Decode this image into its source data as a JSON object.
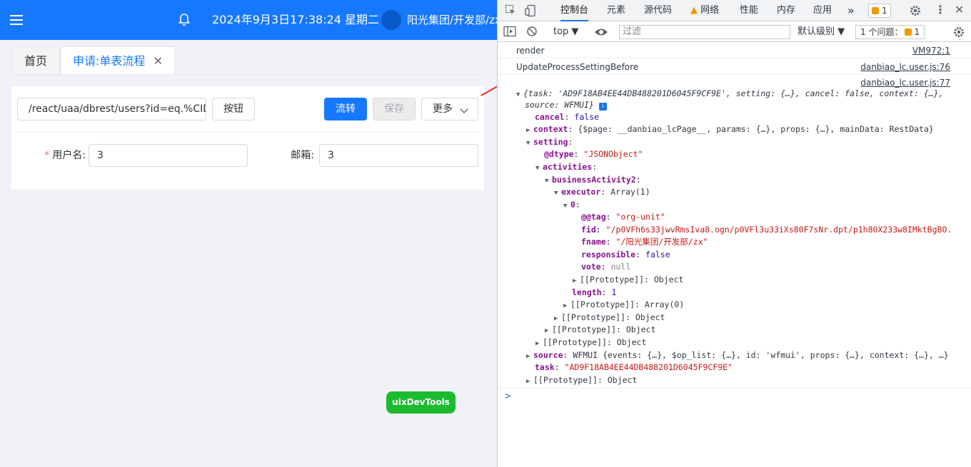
{
  "header": {
    "datetime": "2024年9月3日17:38:24 星期二",
    "user": "阳光集团/开发部/zx",
    "icons": [
      "menu-icon",
      "bell-icon"
    ],
    "color": "#1677ff"
  },
  "tabs": {
    "home": "首页",
    "active": "申请:单表流程",
    "close": "✕"
  },
  "form": {
    "url_value": "/react/uaa/dbrest/users?id=eq.%CID%",
    "btn_button": "按钮",
    "btn_flow": "流转",
    "btn_save": "保存",
    "btn_more": "更多",
    "required_mark": "*",
    "username_label": "用户名:",
    "username_value": "3",
    "email_label": "邮箱:",
    "email_value": "3"
  },
  "uix": {
    "label": "uixDevTools"
  },
  "devtools": {
    "tabs": [
      "控制台",
      "元素",
      "源代码",
      "网络",
      "性能",
      "内存",
      "应用"
    ],
    "more": "»",
    "warn_badge": "1",
    "context": "top ▼",
    "filter_placeholder": "过滤",
    "level": "默认级别 ▼",
    "issues_text": "1 个问题：",
    "issues_count": "1",
    "log": [
      {
        "msg": "render",
        "src": "VM972:1"
      },
      {
        "msg": "UpdateProcessSettingBefore",
        "src": "danbiao_lc.user.js:76"
      },
      {
        "src": "danbiao_lc.user.js:77"
      }
    ],
    "tree": {
      "l0": "{task: 'AD9F18AB4EE44DB488201D6045F9CF9E', setting: {…}, cancel: false, context: {…},",
      "l0b": "source: WFMUI}",
      "cancel_k": "cancel",
      "cancel_v": "false",
      "context_k": "context",
      "context_v": "{$page: __danbiao_lcPage__, params: {…}, props: {…}, mainData: RestData}",
      "setting_k": "setting",
      "dtype_k": "@dtype",
      "dtype_v": "\"JSONObject\"",
      "activities_k": "activities",
      "ba_k": "businessActivity2",
      "executor_k": "executor",
      "executor_v": "Array(1)",
      "zero_k": "0",
      "tag_k": "@@tag",
      "tag_v": "\"org-unit\"",
      "fid_k": "fid",
      "fid_v": "\"/p0VFh6s33jwvRmsIva8.ogn/p0VFl3u33iXs80F7sNr.dpt/p1h80X233w8IMktBgBO.",
      "fname_k": "fname",
      "fname_v": "\"/阳光集团/开发部/zx\"",
      "resp_k": "responsible",
      "resp_v": "false",
      "vote_k": "vote",
      "vote_v": "null",
      "proto_obj": "[[Prototype]]: Object",
      "length_k": "length",
      "length_v": "1",
      "proto_arr": "[[Prototype]]: Array(0)",
      "source_k": "source",
      "source_v": "WFMUI {events: {…}, $op_list: {…}, id: 'wfmui', props: {…}, context: {…}, …}",
      "task_k": "task",
      "task_v": "\"AD9F18AB4EE44DB488201D6045F9CF9E\""
    },
    "prompt": ">"
  }
}
